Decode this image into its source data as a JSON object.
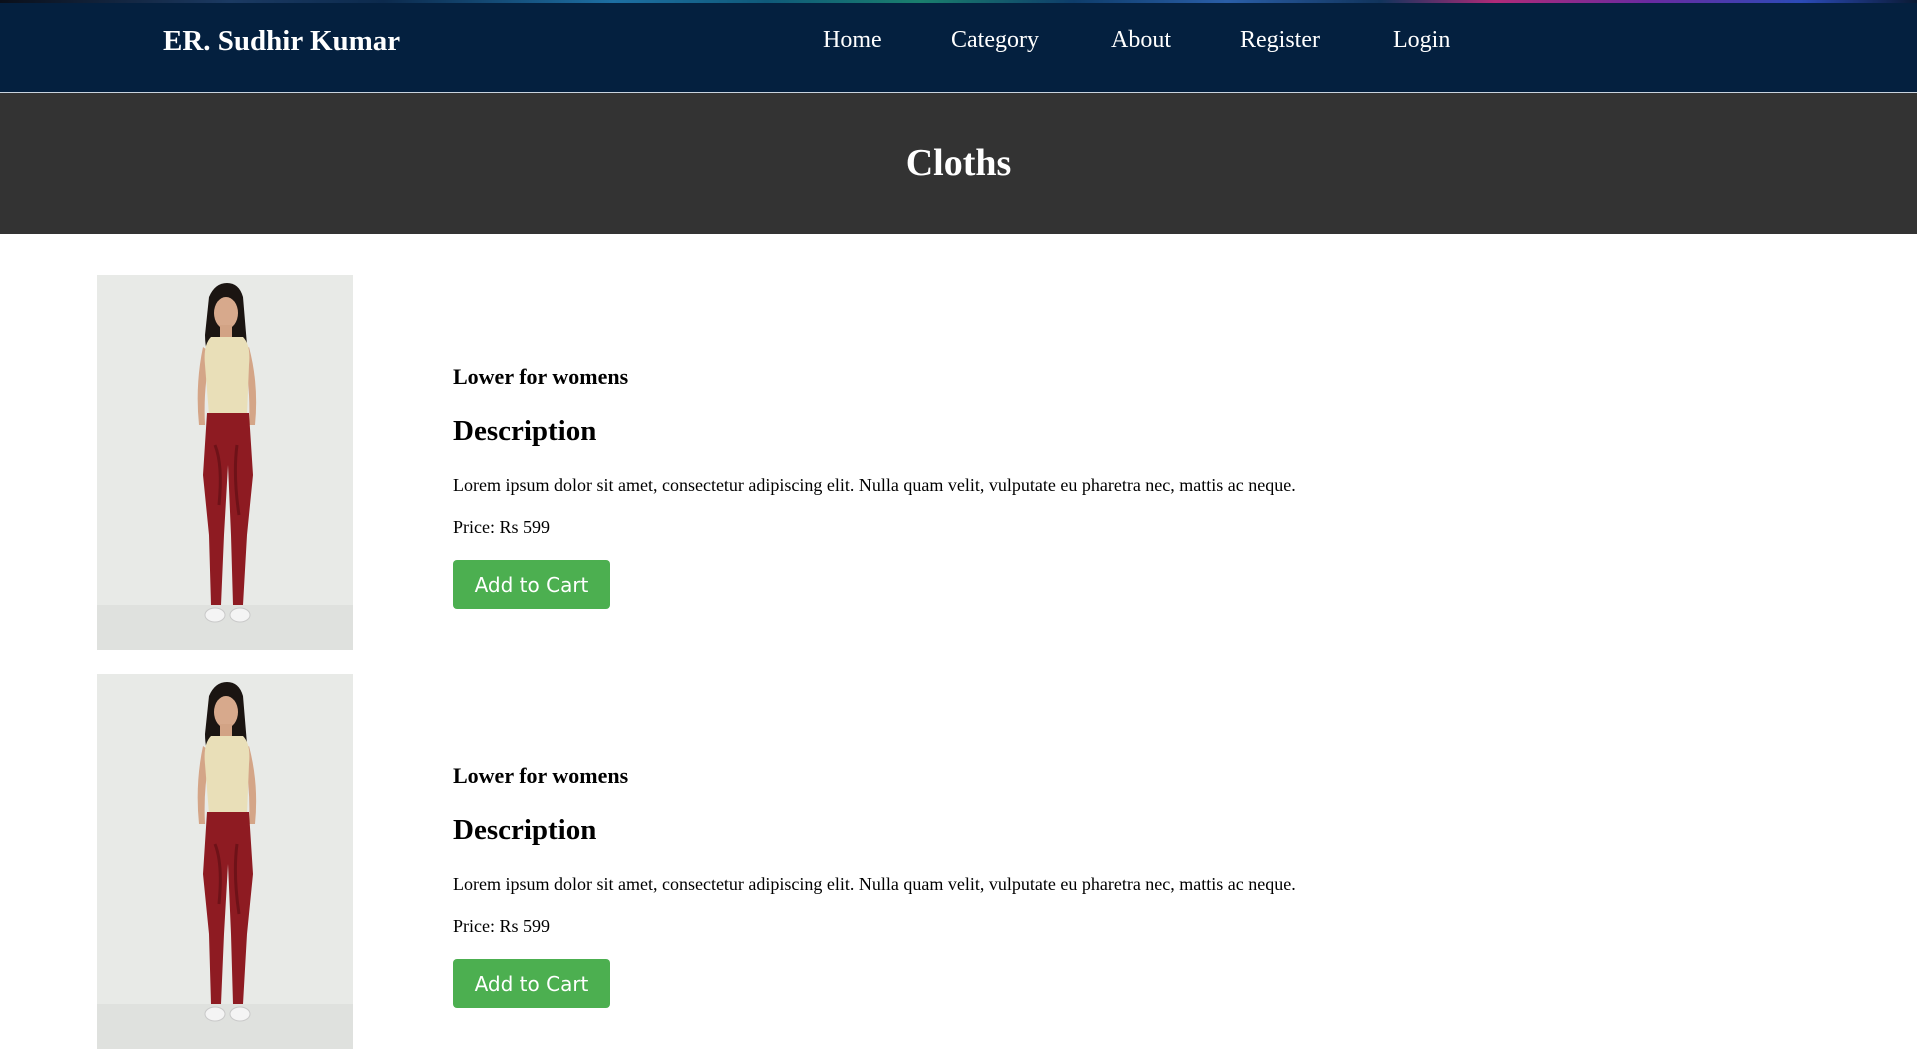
{
  "header": {
    "brand": "ER. Sudhir Kumar",
    "nav": [
      {
        "label": "Home"
      },
      {
        "label": "Category"
      },
      {
        "label": "About"
      },
      {
        "label": "Register"
      },
      {
        "label": "Login"
      }
    ]
  },
  "hero": {
    "title": "Cloths"
  },
  "products": [
    {
      "name": "Lower for womens",
      "description_title": "Description",
      "description": "Lorem ipsum dolor sit amet, consectetur adipiscing elit. Nulla quam velit, vulputate eu pharetra nec, mattis ac neque.",
      "price_label": "Price:",
      "price": "Rs 599",
      "button_label": "Add to Cart",
      "image_icon": "product-photo-woman-red-pants"
    },
    {
      "name": "Lower for womens",
      "description_title": "Description",
      "description": "Lorem ipsum dolor sit amet, consectetur adipiscing elit. Nulla quam velit, vulputate eu pharetra nec, mattis ac neque.",
      "price_label": "Price:",
      "price": "Rs 599",
      "button_label": "Add to Cart",
      "image_icon": "product-photo-woman-red-pants"
    }
  ],
  "colors": {
    "header_bg": "#04203f",
    "hero_bg": "#333333",
    "button_bg": "#4caf50",
    "pants": "#8e1b22",
    "top": "#e9dfb8"
  }
}
